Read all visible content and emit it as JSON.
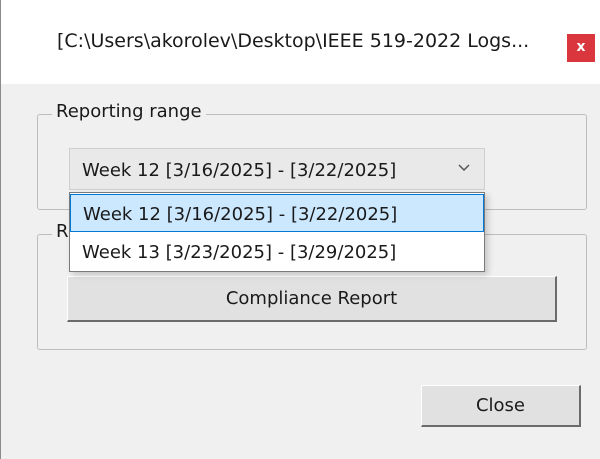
{
  "window": {
    "title": "[C:\\Users\\akorolev\\Desktop\\IEEE 519-2022 Logs...",
    "close_glyph": "x",
    "close_color": "#d9363e"
  },
  "range_group": {
    "legend": "Reporting range",
    "combo_value": "Week 12 [3/16/2025] - [3/22/2025]",
    "dropdown_icon": "chevron-down-icon",
    "options": [
      "Week 12 [3/16/2025] - [3/22/2025]",
      "Week 13 [3/23/2025] - [3/29/2025]"
    ],
    "selected_highlight": "#cce8ff"
  },
  "report_group": {
    "legend": "R",
    "compliance_button": "Compliance Report"
  },
  "footer": {
    "close_button": "Close"
  }
}
